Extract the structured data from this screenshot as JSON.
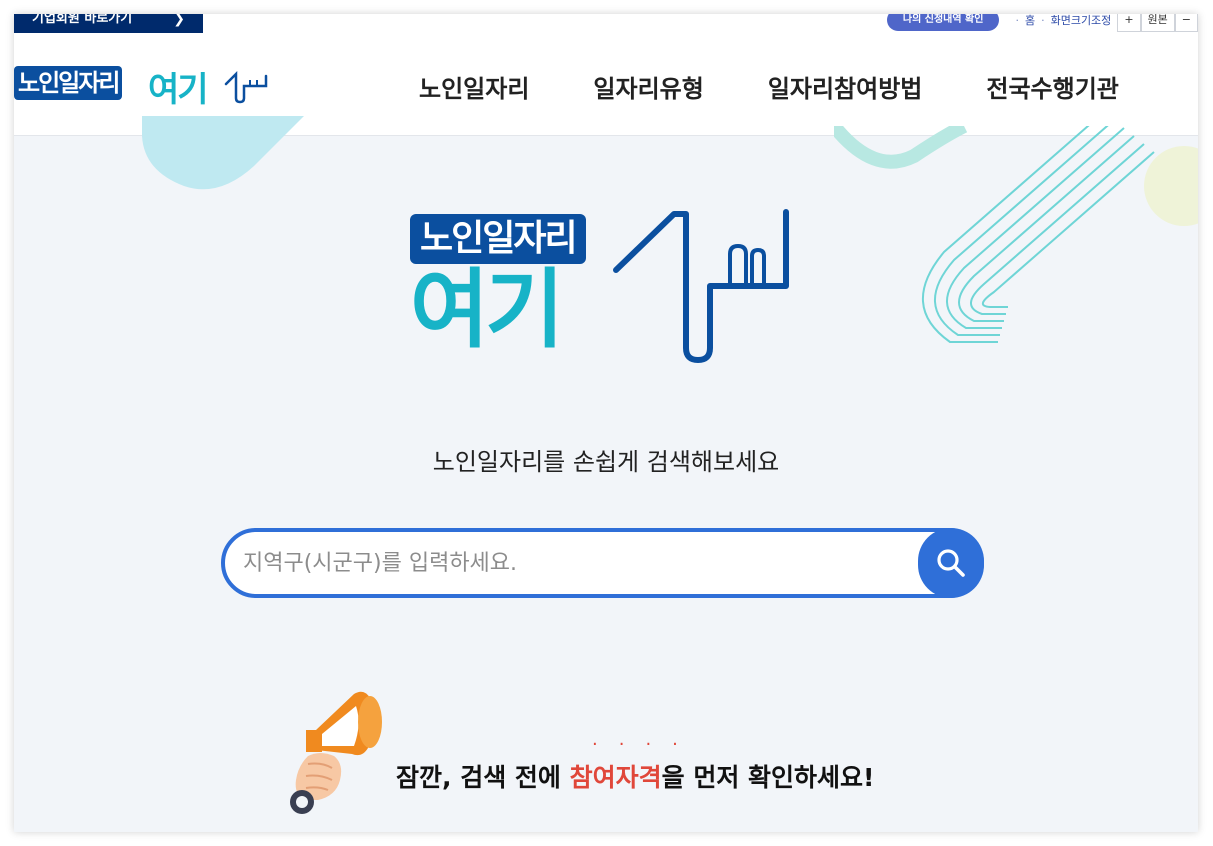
{
  "topbar": {
    "corp_link_label": "기업회원 바로가기",
    "corp_link_arrow": "❯",
    "verify_pill": "나의 신청내역 확인",
    "home_link": "홈",
    "zoom_label": "화면크기조정",
    "zoom_in": "+",
    "zoom_reset": "원본",
    "zoom_out": "−"
  },
  "header": {
    "logo_text": "노인일자리",
    "logo_accent": "여기",
    "nav": [
      {
        "label": "노인일자리"
      },
      {
        "label": "일자리유형"
      },
      {
        "label": "일자리참여방법"
      },
      {
        "label": "전국수행기관"
      }
    ]
  },
  "hero": {
    "logo_text": "노인일자리",
    "logo_accent": "여기",
    "subtitle": "노인일자리를 손쉽게 검색해보세요",
    "search_placeholder": "지역구(시군구)를 입력하세요.",
    "search_button_icon": "search-icon",
    "notice_before": "잠깐, 검색 전에 ",
    "notice_highlight": "참여자격",
    "notice_after": "을 먼저 확인하세요!",
    "notice_emphasis_dots": "····"
  },
  "colors": {
    "navy": "#002a6c",
    "logo_blue": "#0b4f9f",
    "logo_teal": "#17b3c7",
    "search_blue": "#2f6fd8",
    "highlight_red": "#e0473a",
    "hero_bg": "#f2f5f9"
  }
}
